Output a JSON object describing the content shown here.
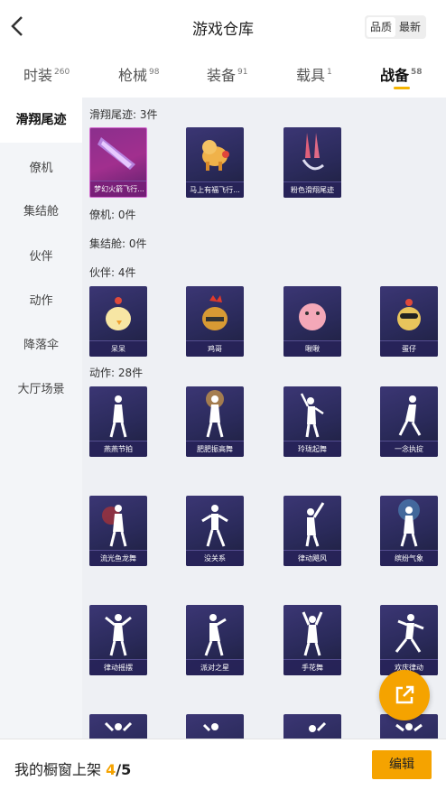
{
  "header": {
    "title": "游戏仓库",
    "sort": [
      "品质",
      "最新"
    ]
  },
  "tabs": [
    {
      "label": "时装",
      "count": "260"
    },
    {
      "label": "枪械",
      "count": "98"
    },
    {
      "label": "装备",
      "count": "91"
    },
    {
      "label": "载具",
      "count": "1"
    },
    {
      "label": "战备",
      "count": "58"
    }
  ],
  "sidebar": [
    "滑翔尾迹",
    "僚机",
    "集结舱",
    "伙伴",
    "动作",
    "降落伞",
    "大厅场景"
  ],
  "sections": {
    "trail": {
      "title": "滑翔尾迹: 3件",
      "items": [
        "梦幻火箭飞行...",
        "马上有福飞行...",
        "粉色滑翔尾迹"
      ]
    },
    "wingman": {
      "title": "僚机: 0件"
    },
    "pod": {
      "title": "集结舱: 0件"
    },
    "partner": {
      "title": "伙伴: 4件",
      "items": [
        "呆呆",
        "鸡哥",
        "啾啾",
        "蛋仔"
      ]
    },
    "emote": {
      "title": "动作: 28件",
      "items": [
        "燕燕节拍",
        "肥肥振高舞",
        "玲珑起舞",
        "一念执掟",
        "流光鱼龙舞",
        "没关系",
        "律动飓风",
        "缤纷气象",
        "律动摇摆",
        "派对之星",
        "手花舞",
        "欢庆律动"
      ]
    }
  },
  "footer": {
    "text": "我的橱窗上架 ",
    "current": "4",
    "total": "/5",
    "edit": "编辑"
  },
  "colors": {
    "accent": "#f5a300"
  },
  "icons": {
    "back": "chevron-left-icon",
    "share": "external-link-icon"
  }
}
